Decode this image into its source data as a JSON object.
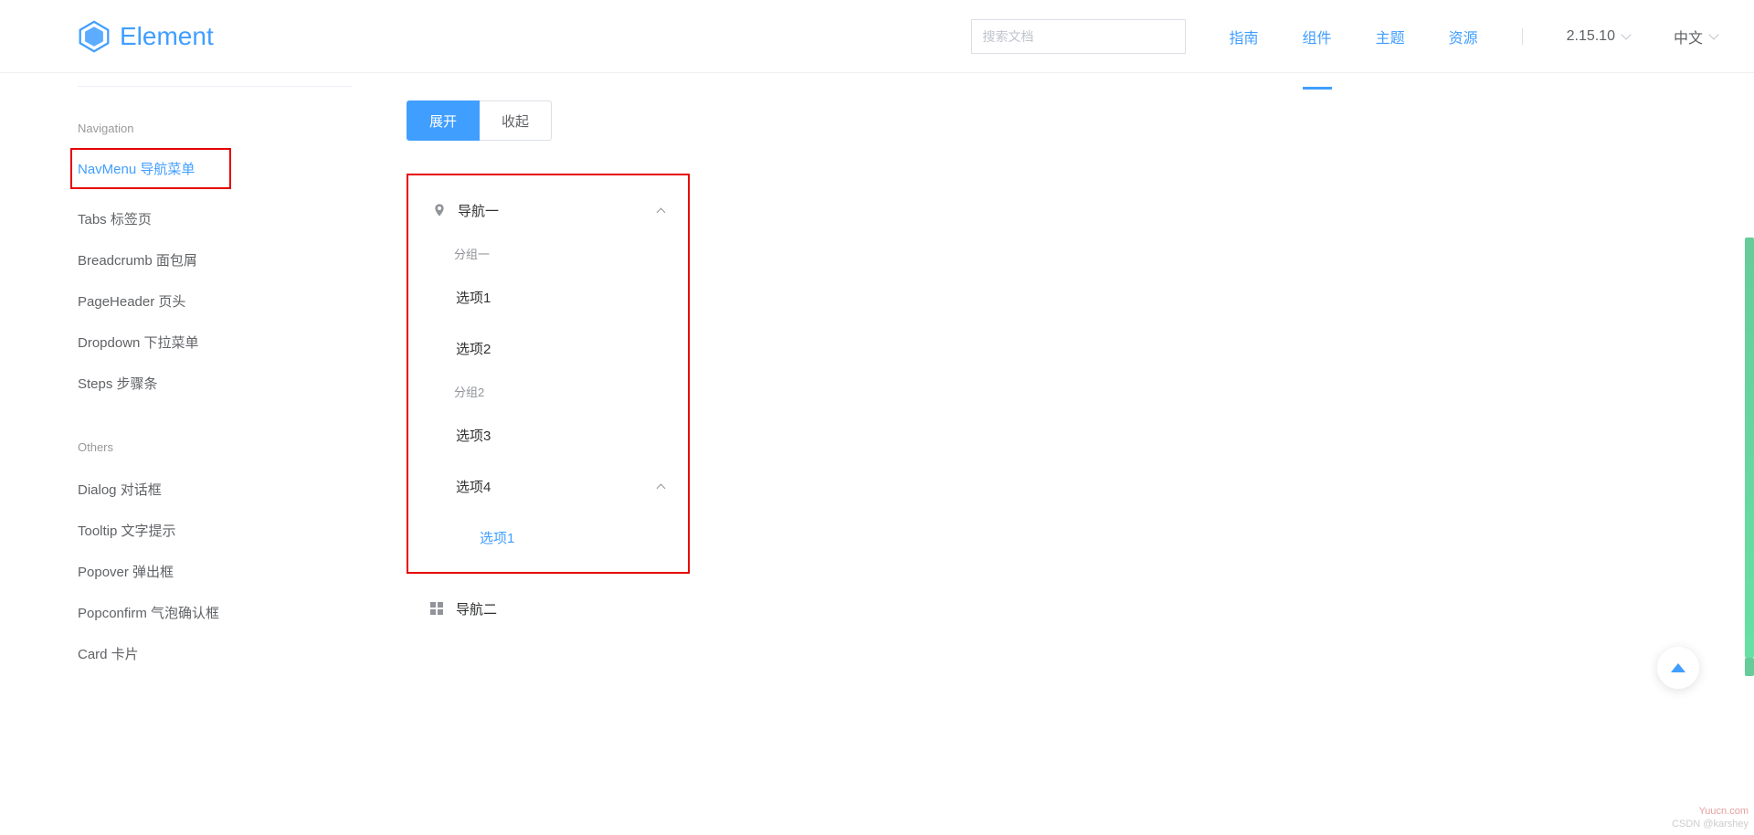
{
  "header": {
    "logo_text": "Element",
    "search_placeholder": "搜索文档",
    "nav": [
      "指南",
      "组件",
      "主题",
      "资源"
    ],
    "nav_active_index": 1,
    "version": "2.15.10",
    "language": "中文"
  },
  "sidebar": {
    "group_navigation": "Navigation",
    "items_nav": [
      "NavMenu 导航菜单",
      "Tabs 标签页",
      "Breadcrumb 面包屑",
      "PageHeader 页头",
      "Dropdown 下拉菜单",
      "Steps 步骤条"
    ],
    "group_others": "Others",
    "items_others": [
      "Dialog 对话框",
      "Tooltip 文字提示",
      "Popover 弹出框",
      "Popconfirm 气泡确认框",
      "Card 卡片"
    ]
  },
  "content": {
    "btn_expand": "展开",
    "btn_collapse": "收起",
    "menu": {
      "nav1": "导航一",
      "group1": "分组一",
      "opt1": "选项1",
      "opt2": "选项2",
      "group2": "分组2",
      "opt3": "选项3",
      "opt4": "选项4",
      "opt4_sub1": "选项1",
      "nav2": "导航二"
    }
  },
  "watermark": {
    "line1": "Yuucn.com",
    "line2": "CSDN @karshey"
  }
}
